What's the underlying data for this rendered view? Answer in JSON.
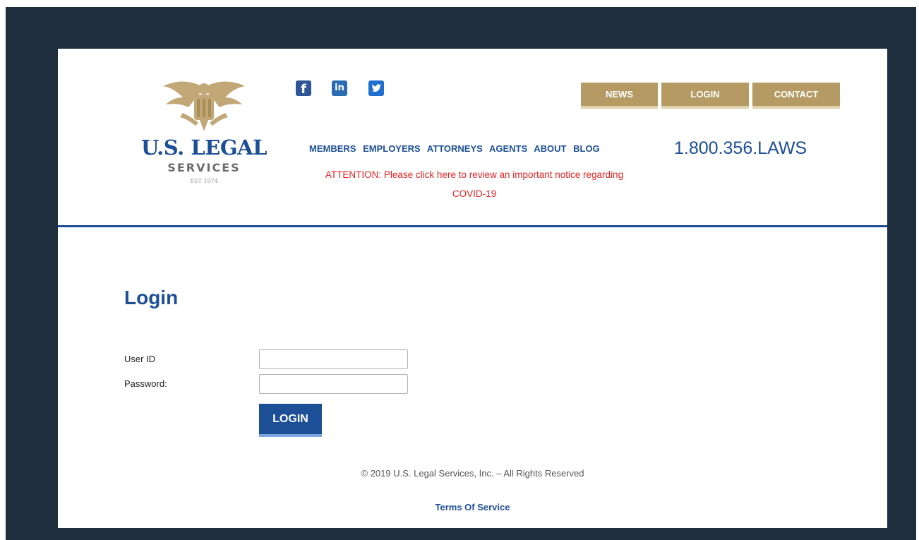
{
  "logo": {
    "name": "U.S. LEGAL",
    "sub": "SERVICES",
    "est": "EST 1974"
  },
  "social": {
    "facebook": "f",
    "linkedin": "in",
    "twitter": "t"
  },
  "top_nav": {
    "news": "NEWS",
    "login": "LOGIN",
    "contact": "CONTACT"
  },
  "main_nav": {
    "items": [
      "MEMBERS",
      "EMPLOYERS",
      "ATTORNEYS",
      "AGENTS",
      "ABOUT",
      "BLOG"
    ]
  },
  "phone": "1.800.356.LAWS",
  "notice": {
    "line1": "ATTENTION: Please click here to review an important notice regarding",
    "line2": "COVID-19"
  },
  "login": {
    "title": "Login",
    "user_label": "User ID",
    "user_value": "",
    "pass_label": "Password:",
    "pass_value": "",
    "button": "LOGIN"
  },
  "footer": {
    "copyright": "© 2019 U.S. Legal Services, Inc. – All Rights Reserved",
    "terms": "Terms Of Service"
  },
  "colors": {
    "brand_blue": "#1d4f96",
    "gold": "#b59a63",
    "notice_red": "#e32222",
    "frame_bg": "#1f2e3d"
  },
  "icons": {
    "eagle": "eagle-seal-icon",
    "facebook": "facebook-icon",
    "linkedin": "linkedin-icon",
    "twitter": "twitter-icon"
  }
}
